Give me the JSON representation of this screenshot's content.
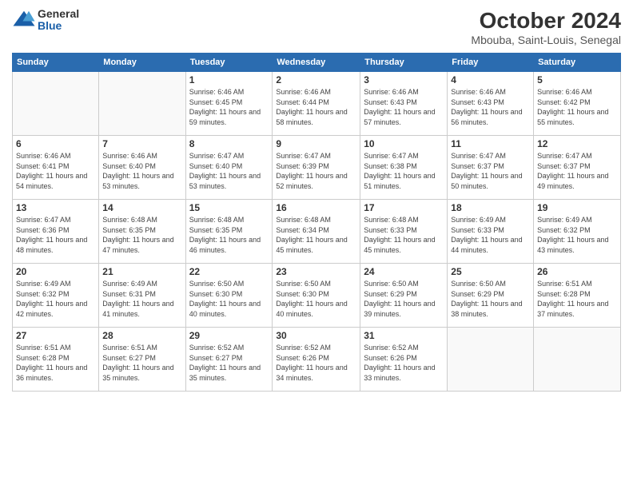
{
  "header": {
    "logo_general": "General",
    "logo_blue": "Blue",
    "month_title": "October 2024",
    "subtitle": "Mbouba, Saint-Louis, Senegal"
  },
  "days_of_week": [
    "Sunday",
    "Monday",
    "Tuesday",
    "Wednesday",
    "Thursday",
    "Friday",
    "Saturday"
  ],
  "weeks": [
    [
      {
        "day": "",
        "info": ""
      },
      {
        "day": "",
        "info": ""
      },
      {
        "day": "1",
        "info": "Sunrise: 6:46 AM\nSunset: 6:45 PM\nDaylight: 11 hours and 59 minutes."
      },
      {
        "day": "2",
        "info": "Sunrise: 6:46 AM\nSunset: 6:44 PM\nDaylight: 11 hours and 58 minutes."
      },
      {
        "day": "3",
        "info": "Sunrise: 6:46 AM\nSunset: 6:43 PM\nDaylight: 11 hours and 57 minutes."
      },
      {
        "day": "4",
        "info": "Sunrise: 6:46 AM\nSunset: 6:43 PM\nDaylight: 11 hours and 56 minutes."
      },
      {
        "day": "5",
        "info": "Sunrise: 6:46 AM\nSunset: 6:42 PM\nDaylight: 11 hours and 55 minutes."
      }
    ],
    [
      {
        "day": "6",
        "info": "Sunrise: 6:46 AM\nSunset: 6:41 PM\nDaylight: 11 hours and 54 minutes."
      },
      {
        "day": "7",
        "info": "Sunrise: 6:46 AM\nSunset: 6:40 PM\nDaylight: 11 hours and 53 minutes."
      },
      {
        "day": "8",
        "info": "Sunrise: 6:47 AM\nSunset: 6:40 PM\nDaylight: 11 hours and 53 minutes."
      },
      {
        "day": "9",
        "info": "Sunrise: 6:47 AM\nSunset: 6:39 PM\nDaylight: 11 hours and 52 minutes."
      },
      {
        "day": "10",
        "info": "Sunrise: 6:47 AM\nSunset: 6:38 PM\nDaylight: 11 hours and 51 minutes."
      },
      {
        "day": "11",
        "info": "Sunrise: 6:47 AM\nSunset: 6:37 PM\nDaylight: 11 hours and 50 minutes."
      },
      {
        "day": "12",
        "info": "Sunrise: 6:47 AM\nSunset: 6:37 PM\nDaylight: 11 hours and 49 minutes."
      }
    ],
    [
      {
        "day": "13",
        "info": "Sunrise: 6:47 AM\nSunset: 6:36 PM\nDaylight: 11 hours and 48 minutes."
      },
      {
        "day": "14",
        "info": "Sunrise: 6:48 AM\nSunset: 6:35 PM\nDaylight: 11 hours and 47 minutes."
      },
      {
        "day": "15",
        "info": "Sunrise: 6:48 AM\nSunset: 6:35 PM\nDaylight: 11 hours and 46 minutes."
      },
      {
        "day": "16",
        "info": "Sunrise: 6:48 AM\nSunset: 6:34 PM\nDaylight: 11 hours and 45 minutes."
      },
      {
        "day": "17",
        "info": "Sunrise: 6:48 AM\nSunset: 6:33 PM\nDaylight: 11 hours and 45 minutes."
      },
      {
        "day": "18",
        "info": "Sunrise: 6:49 AM\nSunset: 6:33 PM\nDaylight: 11 hours and 44 minutes."
      },
      {
        "day": "19",
        "info": "Sunrise: 6:49 AM\nSunset: 6:32 PM\nDaylight: 11 hours and 43 minutes."
      }
    ],
    [
      {
        "day": "20",
        "info": "Sunrise: 6:49 AM\nSunset: 6:32 PM\nDaylight: 11 hours and 42 minutes."
      },
      {
        "day": "21",
        "info": "Sunrise: 6:49 AM\nSunset: 6:31 PM\nDaylight: 11 hours and 41 minutes."
      },
      {
        "day": "22",
        "info": "Sunrise: 6:50 AM\nSunset: 6:30 PM\nDaylight: 11 hours and 40 minutes."
      },
      {
        "day": "23",
        "info": "Sunrise: 6:50 AM\nSunset: 6:30 PM\nDaylight: 11 hours and 40 minutes."
      },
      {
        "day": "24",
        "info": "Sunrise: 6:50 AM\nSunset: 6:29 PM\nDaylight: 11 hours and 39 minutes."
      },
      {
        "day": "25",
        "info": "Sunrise: 6:50 AM\nSunset: 6:29 PM\nDaylight: 11 hours and 38 minutes."
      },
      {
        "day": "26",
        "info": "Sunrise: 6:51 AM\nSunset: 6:28 PM\nDaylight: 11 hours and 37 minutes."
      }
    ],
    [
      {
        "day": "27",
        "info": "Sunrise: 6:51 AM\nSunset: 6:28 PM\nDaylight: 11 hours and 36 minutes."
      },
      {
        "day": "28",
        "info": "Sunrise: 6:51 AM\nSunset: 6:27 PM\nDaylight: 11 hours and 35 minutes."
      },
      {
        "day": "29",
        "info": "Sunrise: 6:52 AM\nSunset: 6:27 PM\nDaylight: 11 hours and 35 minutes."
      },
      {
        "day": "30",
        "info": "Sunrise: 6:52 AM\nSunset: 6:26 PM\nDaylight: 11 hours and 34 minutes."
      },
      {
        "day": "31",
        "info": "Sunrise: 6:52 AM\nSunset: 6:26 PM\nDaylight: 11 hours and 33 minutes."
      },
      {
        "day": "",
        "info": ""
      },
      {
        "day": "",
        "info": ""
      }
    ]
  ]
}
